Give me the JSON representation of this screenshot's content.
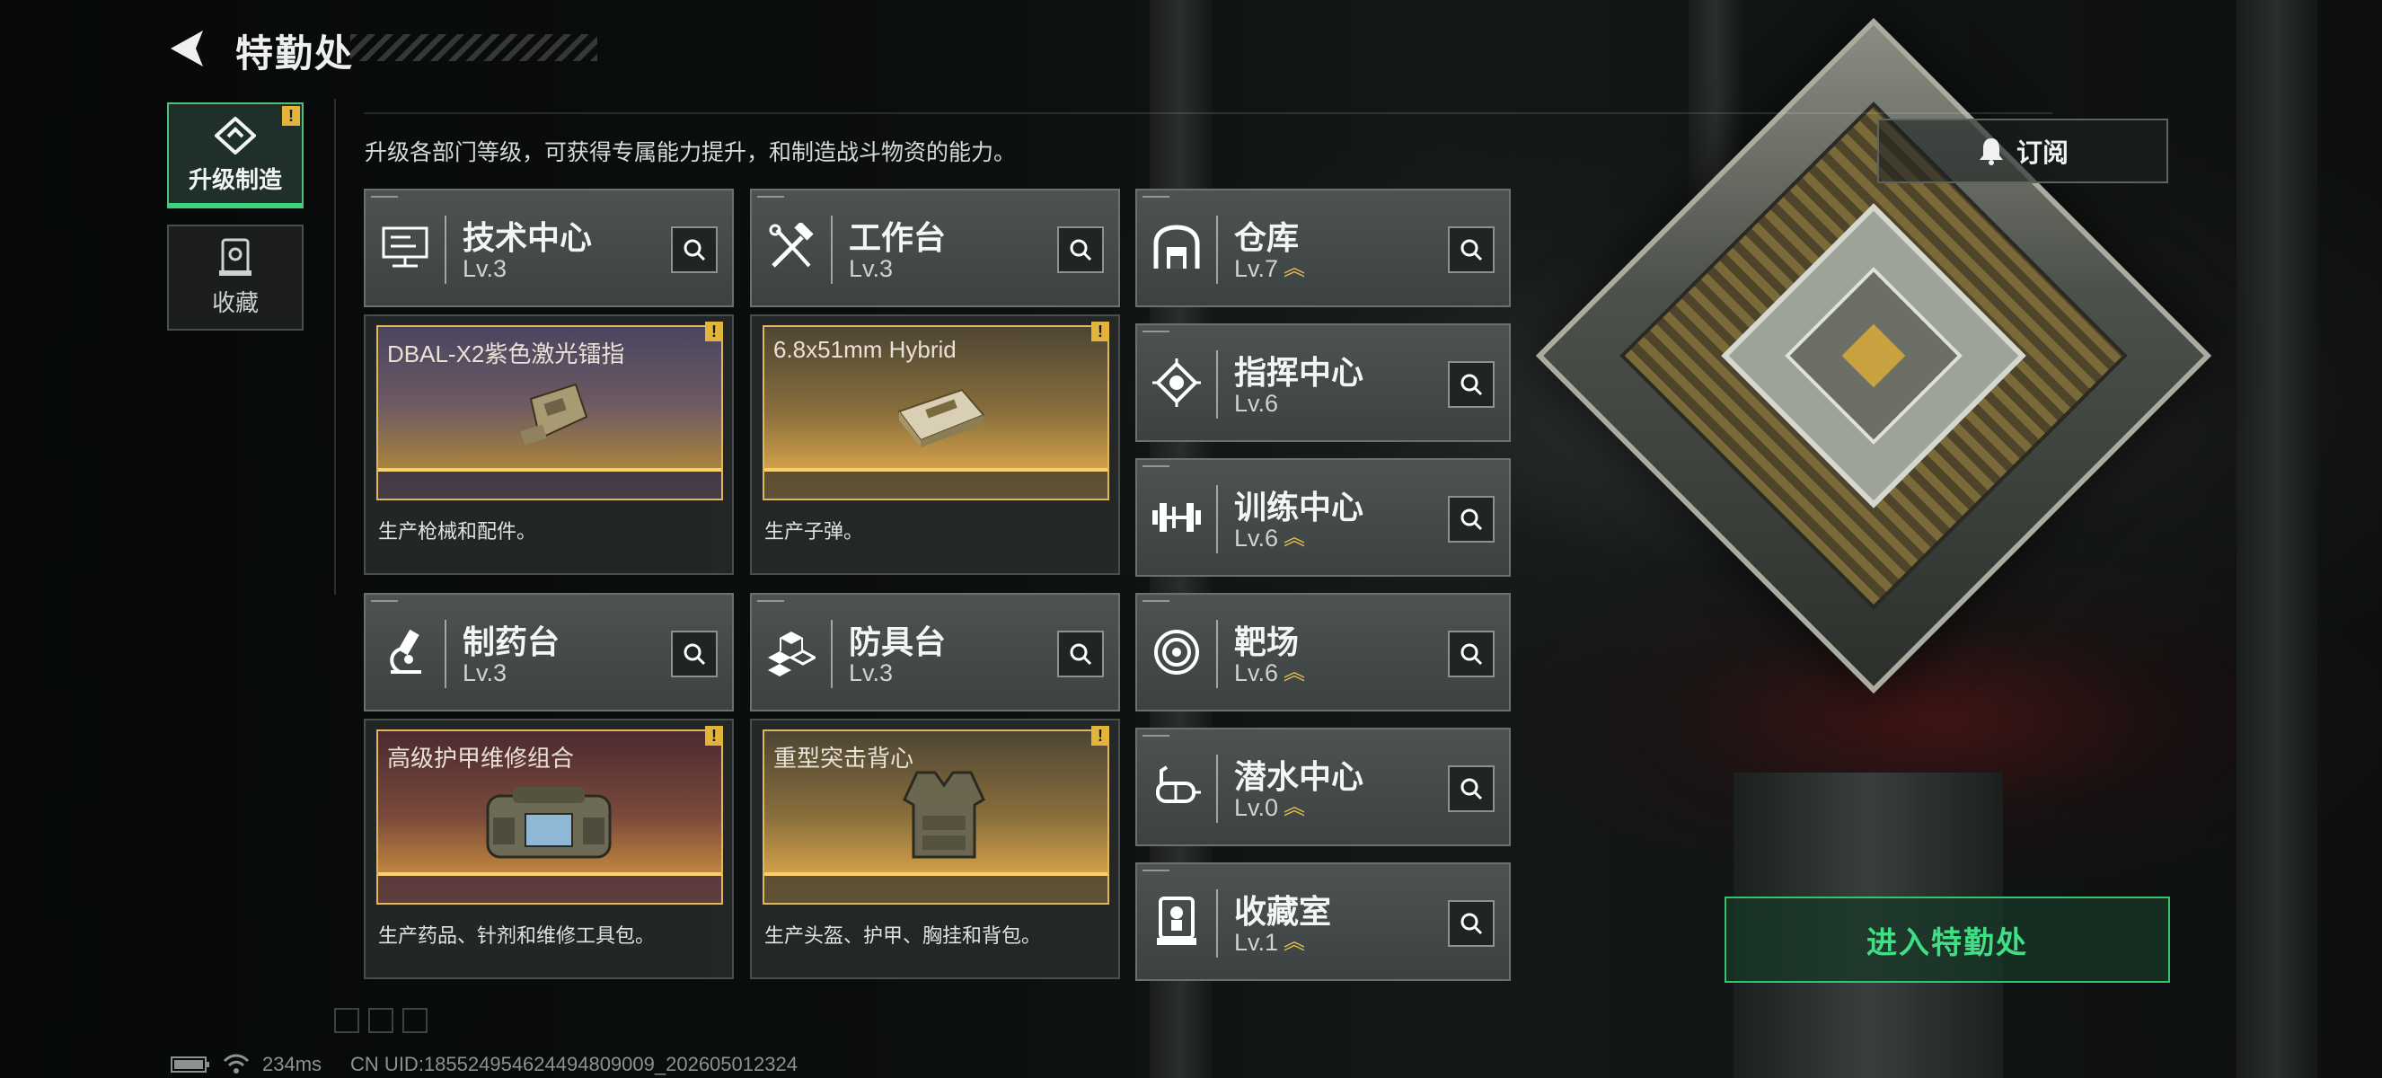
{
  "header": {
    "title": "特勤处"
  },
  "tabs": [
    {
      "label": "升级制造",
      "active": true,
      "alert": "!"
    },
    {
      "label": "收藏",
      "active": false
    }
  ],
  "description": "升级各部门等级，可获得专属能力提升，和制造战斗物资的能力。",
  "subscribe": {
    "label": "订阅"
  },
  "departments": [
    {
      "name": "技术中心",
      "level": "Lv.3",
      "upgradable": false,
      "icon": "circuit-board-icon"
    },
    {
      "name": "工作台",
      "level": "Lv.3",
      "upgradable": false,
      "icon": "tools-icon"
    },
    {
      "name": "仓库",
      "level": "Lv.7",
      "upgradable": true,
      "icon": "warehouse-icon"
    },
    {
      "name": "指挥中心",
      "level": "Lv.6",
      "upgradable": false,
      "icon": "command-chip-icon"
    },
    {
      "name": "训练中心",
      "level": "Lv.6",
      "upgradable": true,
      "icon": "dumbbell-icon"
    },
    {
      "name": "制药台",
      "level": "Lv.3",
      "upgradable": false,
      "icon": "microscope-icon"
    },
    {
      "name": "防具台",
      "level": "Lv.3",
      "upgradable": false,
      "icon": "armor-blocks-icon"
    },
    {
      "name": "靶场",
      "level": "Lv.6",
      "upgradable": true,
      "icon": "target-icon"
    },
    {
      "name": "潜水中心",
      "level": "Lv.0",
      "upgradable": true,
      "icon": "diving-mask-icon"
    },
    {
      "name": "收藏室",
      "level": "Lv.1",
      "upgradable": true,
      "icon": "display-case-icon"
    }
  ],
  "products": [
    {
      "item": "DBAL-X2紫色激光镭指",
      "desc": "生产枪械和配件。",
      "alert": "!",
      "rarity": "purple"
    },
    {
      "item": "6.8x51mm Hybrid",
      "desc": "生产子弹。",
      "alert": "!",
      "rarity": "gold"
    },
    {
      "item": "高级护甲维修组合",
      "desc": "生产药品、针剂和维修工具包。",
      "alert": "!",
      "rarity": "red"
    },
    {
      "item": "重型突击背心",
      "desc": "生产头盔、护甲、胸挂和背包。",
      "alert": "!",
      "rarity": "gold"
    }
  ],
  "enter_button": {
    "label": "进入特勤处"
  },
  "status_bar": {
    "ping": "234ms",
    "uid": "CN UID:18552495462449480​9009_202605012324"
  },
  "colors": {
    "accent_green": "#3fe085",
    "gold": "#e0b85a",
    "alert": "#e3b43a"
  }
}
